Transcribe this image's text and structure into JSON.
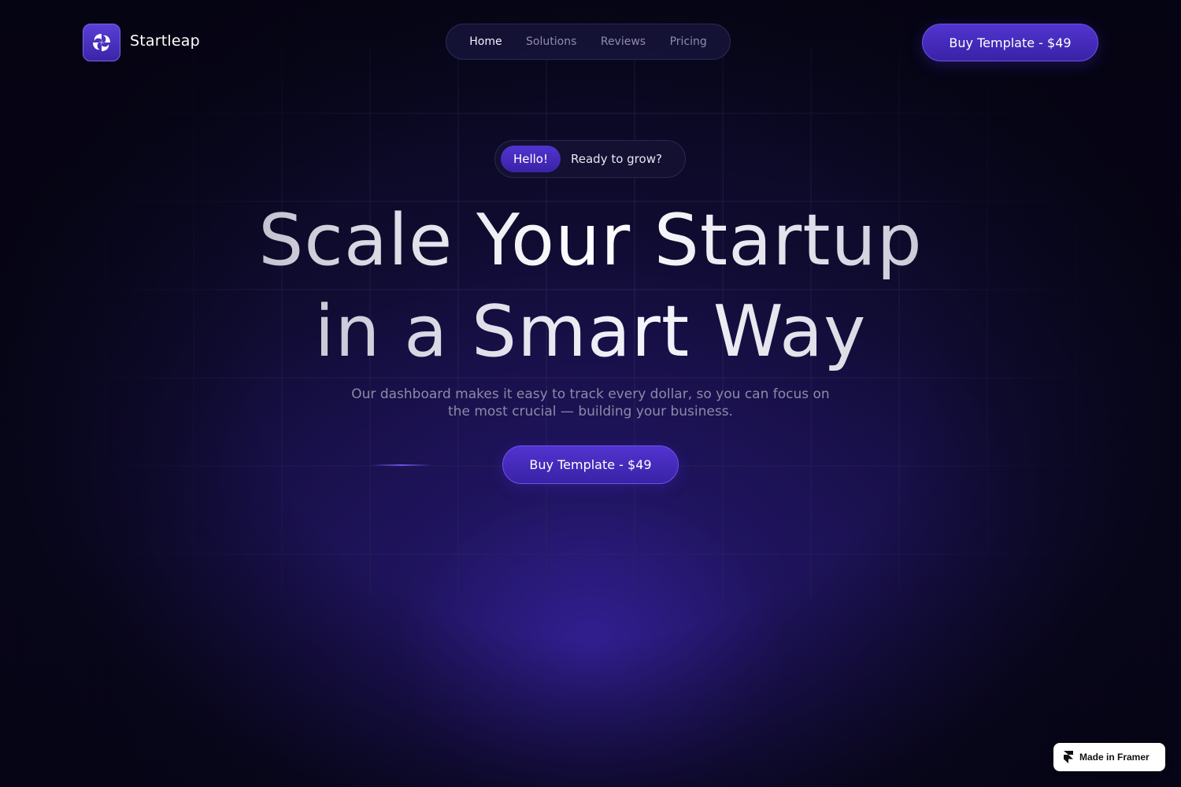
{
  "header": {
    "brand": "Startleap",
    "logo_icon": "swirl-logo-icon",
    "nav": [
      {
        "label": "Home",
        "active": true
      },
      {
        "label": "Solutions",
        "active": false
      },
      {
        "label": "Reviews",
        "active": false
      },
      {
        "label": "Pricing",
        "active": false
      }
    ],
    "cta_label": "Buy Template - $49"
  },
  "hero": {
    "badge": "Hello!",
    "badge_text": "Ready to grow?",
    "headline_line1": "Scale Your Startup",
    "headline_line2": "in a Smart Way",
    "subtitle_line1": "Our dashboard makes it easy to track every dollar, so you can focus on",
    "subtitle_line2": "the most crucial — building your business.",
    "cta_label": "Buy Template - $49"
  },
  "footer_badge": {
    "label": "Made in Framer",
    "icon": "framer-icon"
  },
  "colors": {
    "background": "#07061a",
    "accent": "#4a2fc4",
    "accent_border": "#6c52e6",
    "nav_inactive": "#8e8cae",
    "nav_active": "#f2f2ff"
  }
}
